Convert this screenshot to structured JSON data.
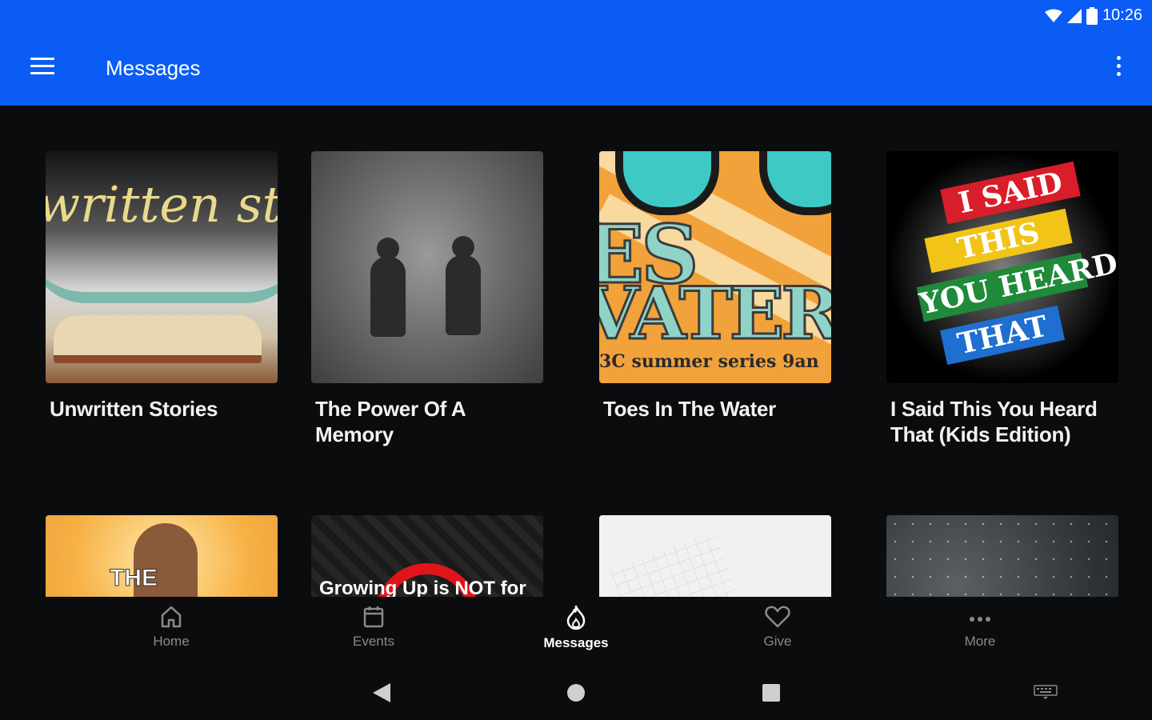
{
  "status_bar": {
    "time": "10:26"
  },
  "app_bar": {
    "title": "Messages",
    "color": "#0a5cf5"
  },
  "messages": [
    {
      "title": "Unwritten Stories",
      "thumb_text": "written sto"
    },
    {
      "title": "The Power Of A Memory"
    },
    {
      "title": "Toes In The Water",
      "thumb_line1": "ES",
      "thumb_line2": "VATER",
      "thumb_sub": "3C summer series   9an"
    },
    {
      "title": "I Said This You Heard That (Kids Edition)",
      "thumb_banners": [
        "I SAID",
        "THIS",
        "YOU HEARD",
        "THAT"
      ]
    },
    {
      "title": "",
      "thumb_text": "THE"
    },
    {
      "title": "",
      "thumb_text": "Growing Up is NOT for"
    },
    {
      "title": ""
    },
    {
      "title": ""
    }
  ],
  "bottom_nav": [
    {
      "label": "Home",
      "icon": "home-icon"
    },
    {
      "label": "Events",
      "icon": "calendar-icon"
    },
    {
      "label": "Messages",
      "icon": "flame-icon",
      "active": true
    },
    {
      "label": "Give",
      "icon": "heart-icon"
    },
    {
      "label": "More",
      "icon": "more-dots-icon"
    }
  ]
}
